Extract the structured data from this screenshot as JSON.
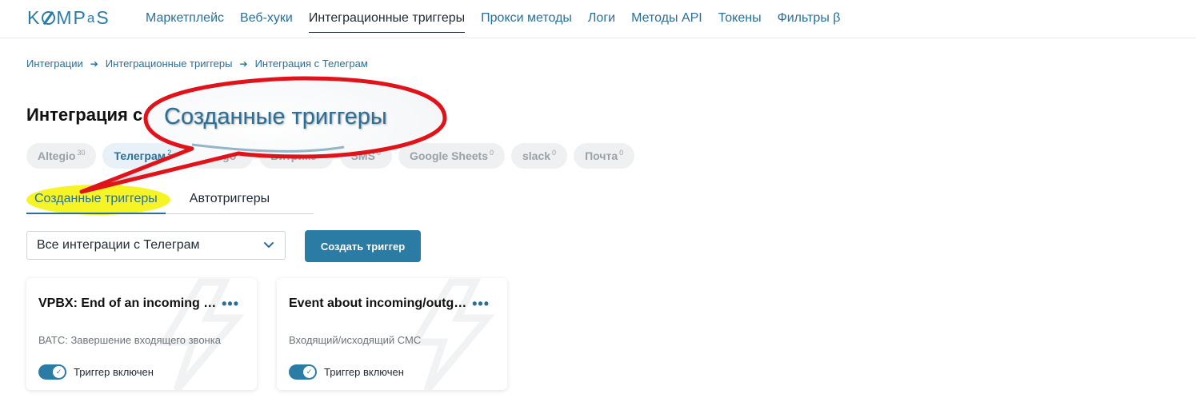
{
  "brand": {
    "logo_pre": "K",
    "logo_post": "MP",
    "logo_a": "a",
    "logo_s": "S",
    "accent": "#2a7ca8"
  },
  "nav": {
    "items": [
      {
        "label": "Маркетплейс"
      },
      {
        "label": "Веб-хуки"
      },
      {
        "label": "Интеграционные триггеры"
      },
      {
        "label": "Прокси методы"
      },
      {
        "label": "Логи"
      },
      {
        "label": "Методы API"
      },
      {
        "label": "Токены"
      },
      {
        "label": "Фильтры β"
      }
    ],
    "active_index": 2
  },
  "breadcrumb": [
    {
      "label": "Интеграции"
    },
    {
      "label": "Интеграционные триггеры"
    },
    {
      "label": "Интеграция с Телеграм"
    }
  ],
  "page_title": "Интеграция с Телеграм",
  "chips": [
    {
      "label": "Altegio",
      "count": "30"
    },
    {
      "label": "Телеграм",
      "count": "2"
    },
    {
      "label": "Mango",
      "count": "0"
    },
    {
      "label": "Битрикс",
      "count": "0"
    },
    {
      "label": "SMS",
      "count": "0"
    },
    {
      "label": "Google Sheets",
      "count": "0"
    },
    {
      "label": "slack",
      "count": "0"
    },
    {
      "label": "Почта",
      "count": "0"
    }
  ],
  "tabs": [
    {
      "label": "Созданные триггеры"
    },
    {
      "label": "Автотриггеры"
    }
  ],
  "filter": {
    "selected": "Все интеграции с Телеграм"
  },
  "create_button": "Создать триггер",
  "cards": [
    {
      "title": "VPBX: End of an incoming call",
      "description": "ВАТС: Завершение входящего звонка",
      "toggle_label": "Триггер включен",
      "enabled": true
    },
    {
      "title": "Event about incoming/outgoing SMS",
      "description": "Входящий/исходящий СМС",
      "toggle_label": "Триггер включен",
      "enabled": true
    }
  ],
  "callout": {
    "text": "Созданные триггеры",
    "border_color": "#e0121a"
  }
}
